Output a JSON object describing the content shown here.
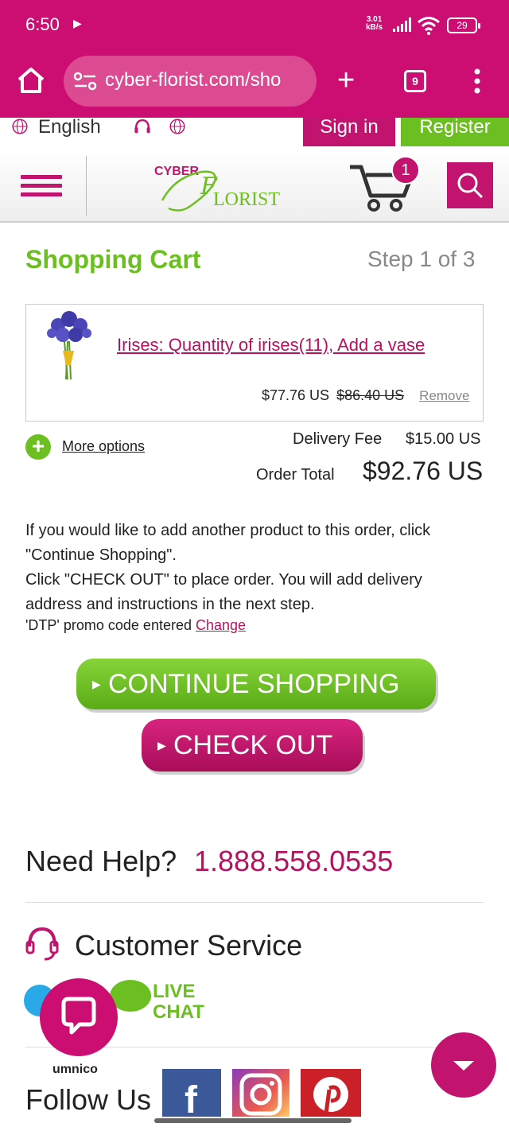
{
  "status": {
    "time": "6:50",
    "net_speed": "3.01",
    "net_unit": "kB/s",
    "battery": "29",
    "icons": [
      "play-icon",
      "signal-icon",
      "wifi-icon",
      "battery-icon"
    ]
  },
  "browser": {
    "url": "cyber-florist.com/sho",
    "tab_count": "9",
    "accent": "#cc0e72"
  },
  "topbar": {
    "language": "English",
    "signin": "Sign in",
    "register": "Register"
  },
  "header": {
    "logo_top": "CYBER",
    "logo_script": "F",
    "logo_rest": "LORIST",
    "cart_count": "1"
  },
  "cart": {
    "title": "Shopping Cart",
    "step": "Step 1 of 3",
    "item": {
      "name": "Irises: Quantity of irises(11), Add a vase",
      "price": "$77.76 US",
      "old_price": "$86.40 US",
      "remove": "Remove"
    },
    "more_options": "More options",
    "delivery_fee_label": "Delivery Fee",
    "delivery_fee": "$15.00 US",
    "order_total_label": "Order Total",
    "order_total": "$92.76 US"
  },
  "info": {
    "line1": "If you would like to add another product to this order, click \"Continue Shopping\".",
    "line2": "Click \"CHECK OUT\" to place order. You will add delivery address and instructions in the next step.",
    "promo_text": "'DTP' promo code entered ",
    "promo_link": "Change"
  },
  "buttons": {
    "continue": "CONTINUE SHOPPING",
    "checkout": "CHECK OUT"
  },
  "footer": {
    "help_label": "Need Help?",
    "phone": "1.888.558.0535",
    "customer_service": "Customer Service",
    "live_chat_1": "LIVE",
    "live_chat_2": "CHAT",
    "chat_widget": "umnico",
    "follow_us": "Follow Us",
    "facebook_letter": "f"
  },
  "colors": {
    "brand_pink": "#c2136f",
    "brand_green": "#6cbf21"
  }
}
